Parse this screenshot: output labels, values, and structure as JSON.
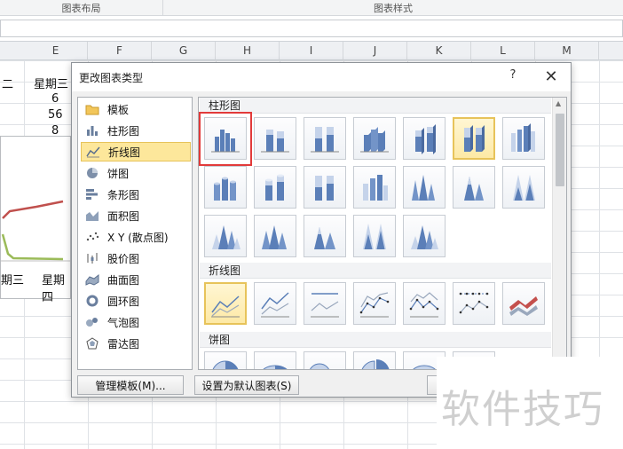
{
  "ribbon": {
    "groups": [
      "图表布局",
      "图表样式"
    ]
  },
  "columns": [
    "E",
    "F",
    "G",
    "H",
    "I",
    "J",
    "K",
    "L",
    "M"
  ],
  "sheet": {
    "cells": [
      {
        "text": "二"
      },
      {
        "text": "星期三"
      },
      {
        "text": "6"
      },
      {
        "text": "56"
      },
      {
        "text": "8"
      },
      {
        "text": "期三"
      },
      {
        "text": "星期四"
      }
    ]
  },
  "dialog": {
    "title": "更改图表类型",
    "help": "?",
    "close": "✕",
    "chart_types": [
      {
        "label": "模板",
        "icon": "folder-icon"
      },
      {
        "label": "柱形图",
        "icon": "column-chart-icon"
      },
      {
        "label": "折线图",
        "icon": "line-chart-icon",
        "selected": true
      },
      {
        "label": "饼图",
        "icon": "pie-chart-icon"
      },
      {
        "label": "条形图",
        "icon": "bar-chart-icon"
      },
      {
        "label": "面积图",
        "icon": "area-chart-icon"
      },
      {
        "label": "X Y (散点图)",
        "icon": "scatter-chart-icon"
      },
      {
        "label": "股价图",
        "icon": "stock-chart-icon"
      },
      {
        "label": "曲面图",
        "icon": "surface-chart-icon"
      },
      {
        "label": "圆环图",
        "icon": "doughnut-chart-icon"
      },
      {
        "label": "气泡图",
        "icon": "bubble-chart-icon"
      },
      {
        "label": "雷达图",
        "icon": "radar-chart-icon"
      }
    ],
    "sections": {
      "column": "柱形图",
      "line": "折线图",
      "pie": "饼图"
    },
    "buttons": {
      "manage_templates": "管理模板(M)...",
      "set_default": "设置为默认图表(S)"
    }
  },
  "watermark": "软件技巧",
  "colors": {
    "selection_yellow": "#fde79b",
    "highlight_red": "#e23a3a",
    "thumb_blue": "#5b7fb8",
    "line_red": "#c0504d",
    "line_green": "#9bbb59"
  }
}
